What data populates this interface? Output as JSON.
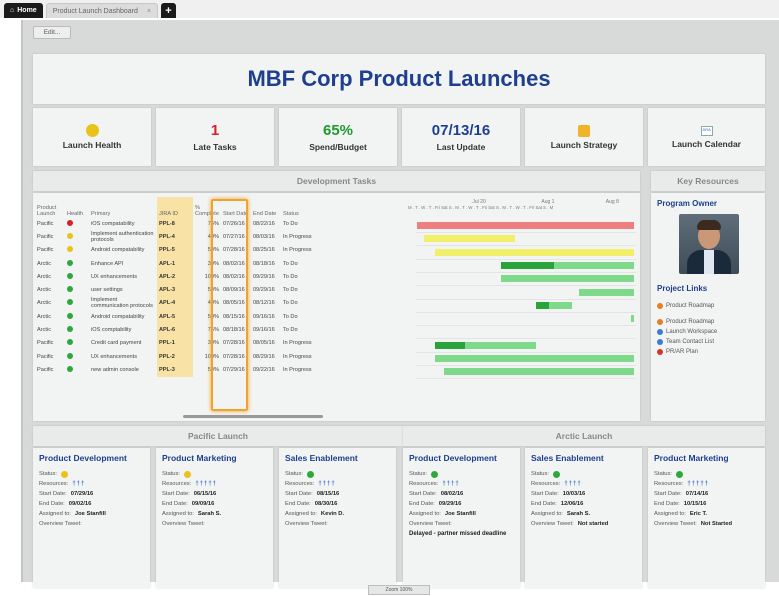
{
  "tabs": {
    "home": "Home",
    "doc": "Product Launch Dashboard",
    "add": "+"
  },
  "edit_label": "Edit...",
  "title": "MBF Corp Product Launches",
  "kpis": {
    "health_label": "Launch Health",
    "late_value": "1",
    "late_label": "Late Tasks",
    "spend_value": "65%",
    "spend_label": "Spend/Budget",
    "update_value": "07/13/16",
    "update_label": "Last Update",
    "strategy_label": "Launch Strategy",
    "calendar_label": "Launch Calendar",
    "calendar_icon_text": "JIRA"
  },
  "dev_title": "Development Tasks",
  "key_title": "Key Resources",
  "table_headers": [
    "Product Launch",
    "Health",
    "Primary",
    "JIRA ID",
    "% Complete",
    "Start Date",
    "End Date",
    "Status"
  ],
  "gantt_header": [
    "Jul 20",
    "Aug 1",
    "Aug 8",
    "M . T . W . T . Fri Sat S . M . T . W . T . Fri Sat S . M . T . W . T . Fri Sat S . M"
  ],
  "tasks": [
    {
      "launch": "Pacific",
      "health": "#d81f2a",
      "primary": "iOS compatability",
      "jira": "PPL-8",
      "pct": "75%",
      "start": "07/26/16",
      "end": "08/22/16",
      "status": "To Do",
      "bar": [
        0.04,
        0.99
      ],
      "barColor": "#ef7f7f",
      "doneTo": 0.04
    },
    {
      "launch": "Pacific",
      "health": "#e9c21a",
      "primary": "Implement authentication protocols",
      "jira": "PPL-4",
      "pct": "40%",
      "start": "07/27/16",
      "end": "08/03/16",
      "status": "In Progress",
      "bar": [
        0.07,
        0.47
      ],
      "barColor": "#f2ef6a",
      "doneTo": 0.07
    },
    {
      "launch": "Pacific",
      "health": "#e9c21a",
      "primary": "Android compatability",
      "jira": "PPL-5",
      "pct": "50%",
      "start": "07/28/16",
      "end": "08/25/16",
      "status": "In Progress",
      "bar": [
        0.12,
        0.99
      ],
      "barColor": "#f2ef6a",
      "doneTo": 0.12
    },
    {
      "launch": "Arctic",
      "health": "#2ea83a",
      "primary": "Enhance API",
      "jira": "APL-1",
      "pct": "30%",
      "start": "08/02/16",
      "end": "08/18/16",
      "status": "To Do",
      "bar": [
        0.41,
        0.99
      ],
      "barColor": "#7fd98a",
      "doneTo": 0.64
    },
    {
      "launch": "Arctic",
      "health": "#2ea83a",
      "primary": "UX enhancements",
      "jira": "APL-2",
      "pct": "100%",
      "start": "08/02/16",
      "end": "09/29/16",
      "status": "To Do",
      "bar": [
        0.41,
        0.99
      ],
      "barColor": "#7fd98a",
      "doneTo": 0.41
    },
    {
      "launch": "Arctic",
      "health": "#2ea83a",
      "primary": "user settings",
      "jira": "APL-3",
      "pct": "50%",
      "start": "08/09/16",
      "end": "09/29/16",
      "status": "To Do",
      "bar": [
        0.75,
        0.99
      ],
      "barColor": "#7fd98a",
      "doneTo": 0.75
    },
    {
      "launch": "Arctic",
      "health": "#2ea83a",
      "primary": "Implement communication protocols",
      "jira": "APL-4",
      "pct": "40%",
      "start": "08/05/16",
      "end": "08/12/16",
      "status": "To Do",
      "bar": [
        0.56,
        0.72
      ],
      "barColor": "#7fd98a",
      "doneTo": 0.62
    },
    {
      "launch": "Arctic",
      "health": "#2ea83a",
      "primary": "Android compatability",
      "jira": "APL-5",
      "pct": "50%",
      "start": "08/15/16",
      "end": "09/16/16",
      "status": "To Do",
      "bar": [
        0.98,
        0.99
      ],
      "barColor": "#7fd98a",
      "doneTo": 0.98
    },
    {
      "launch": "Arctic",
      "health": "#2ea83a",
      "primary": "iOS comptability",
      "jira": "APL-6",
      "pct": "75%",
      "start": "08/18/16",
      "end": "09/16/16",
      "status": "To Do",
      "bar": [
        0.99,
        0.99
      ],
      "barColor": "#7fd98a",
      "doneTo": 0.99
    },
    {
      "launch": "Pacific",
      "health": "#2ea83a",
      "primary": "Credit card payment",
      "jira": "PPL-1",
      "pct": "30%",
      "start": "07/28/16",
      "end": "08/05/16",
      "status": "In Progress",
      "bar": [
        0.12,
        0.56
      ],
      "barColor": "#7fd98a",
      "doneTo": 0.25
    },
    {
      "launch": "Pacific",
      "health": "#2ea83a",
      "primary": "UX enhancements",
      "jira": "PPL-2",
      "pct": "100%",
      "start": "07/28/16",
      "end": "08/29/16",
      "status": "In Progress",
      "bar": [
        0.12,
        0.99
      ],
      "barColor": "#7fd98a",
      "doneTo": 0.12
    },
    {
      "launch": "Pacific",
      "health": "#2ea83a",
      "primary": "new admin console",
      "jira": "PPL-3",
      "pct": "50%",
      "start": "07/29/16",
      "end": "09/22/16",
      "status": "In Progress",
      "bar": [
        0.16,
        0.99
      ],
      "barColor": "#7fd98a",
      "doneTo": 0.16
    }
  ],
  "resources": {
    "owner_title": "Program Owner",
    "links_title": "Project Links",
    "links": [
      {
        "label": "Product Roadmap",
        "color": "#e67e22"
      },
      {
        "label": "Product Roadmap",
        "color": "#e67e22"
      },
      {
        "label": "Launch Workspace",
        "color": "#3a7bd5"
      },
      {
        "label": "Team Contact List",
        "color": "#3a7bd5"
      },
      {
        "label": "PR/AR Plan",
        "color": "#d9342b"
      }
    ]
  },
  "pacific_title": "Pacific Launch",
  "arctic_title": "Arctic Launch",
  "labels": {
    "status": "Status:",
    "resources": "Resources:",
    "start": "Start Date:",
    "end": "End Date:",
    "assigned": "Assigned to:",
    "tweet": "Overview Tweet:"
  },
  "cards": [
    {
      "title": "Product Development",
      "status_color": "#e9c21a",
      "people": "†††",
      "start": "07/29/16",
      "end": "09/02/16",
      "assigned": "Joe Stanfill",
      "tweet": ""
    },
    {
      "title": "Product Marketing",
      "status_color": "#e9c21a",
      "people": "†††††",
      "start": "06/15/16",
      "end": "09/09/16",
      "assigned": "Sarah S.",
      "tweet": ""
    },
    {
      "title": "Sales Enablement",
      "status_color": "#2ea83a",
      "people": "††††",
      "start": "08/15/16",
      "end": "08/30/16",
      "assigned": "Kevin D.",
      "tweet": ""
    },
    {
      "title": "Product Development",
      "status_color": "#2ea83a",
      "people": "††††",
      "start": "08/02/16",
      "end": "09/29/16",
      "assigned": "Joe Stanfill",
      "tweet": "Delayed - partner missed deadline"
    },
    {
      "title": "Sales Enablement",
      "status_color": "#2ea83a",
      "people": "††††",
      "start": "10/03/16",
      "end": "12/06/16",
      "assigned": "Sarah S.",
      "tweet": "Not started"
    },
    {
      "title": "Product Marketing",
      "status_color": "#2ea83a",
      "people": "†††††",
      "start": "07/14/16",
      "end": "10/15/16",
      "assigned": "Eric T.",
      "tweet": "Not Started"
    }
  ],
  "statusbar": "Zoom 100%"
}
